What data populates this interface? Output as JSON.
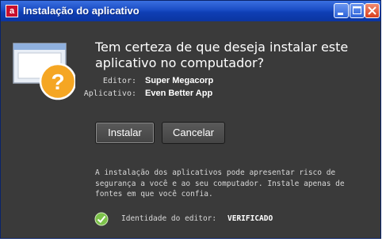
{
  "window": {
    "title": "Instalação do aplicativo",
    "logo_letter": "a"
  },
  "dialog": {
    "question_line1": "Tem certeza de que deseja instalar este",
    "question_line2": "aplicativo no computador?",
    "publisher_label": "Editor:",
    "publisher_value": "Super Megacorp",
    "app_label": "Aplicativo:",
    "app_value": "Even Better App",
    "install_button": "Instalar",
    "cancel_button": "Cancelar",
    "warning_line1": "A instalação dos aplicativos pode apresentar risco de",
    "warning_line2": "segurança a você e ao seu computador. Instale apenas de",
    "warning_line3": "fontes em que você confia.",
    "identity_label": "Identidade do editor:",
    "identity_status": "VERIFICADO"
  },
  "colors": {
    "titlebar": "#1a4cc4",
    "dialog_bg": "#3a3a3a",
    "question_icon": "#f5a623",
    "verified": "#7cc24a"
  },
  "icons": {
    "app_logo": "adobe-air-icon",
    "dialog": "question-window-icon",
    "verified": "checkmark-circle-icon",
    "minimize": "minimize-icon",
    "maximize": "maximize-icon",
    "close": "close-icon"
  }
}
